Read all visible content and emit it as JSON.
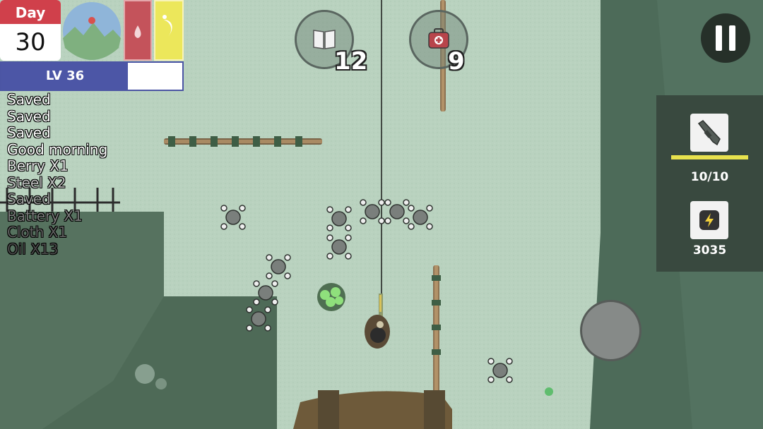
{
  "hud": {
    "day_label": "Day",
    "day_number": "30",
    "level_label": "LV 36",
    "level_progress": 0.7,
    "hydration_icon": "water-drop-icon",
    "hunger_icon": "food-crescent-icon"
  },
  "log": [
    {
      "text": "Saved",
      "color": "#ffffff"
    },
    {
      "text": "Saved",
      "color": "#ffffff"
    },
    {
      "text": "Saved",
      "color": "#ffffff"
    },
    {
      "text": "Good morning",
      "color": "#ffffff"
    },
    {
      "text": "Berry X1",
      "color": "#e4e4e4"
    },
    {
      "text": "Steel X2",
      "color": "#bcbcbc"
    },
    {
      "text": "Saved",
      "color": "#9b9b9b"
    },
    {
      "text": "Battery X1",
      "color": "#7b7b7b"
    },
    {
      "text": "Cloth X1",
      "color": "#5f5f5f"
    },
    {
      "text": "Oil X13",
      "color": "#4a4a4a"
    }
  ],
  "quick_items": {
    "journal": {
      "icon": "book-icon",
      "count": "12"
    },
    "medkit": {
      "icon": "first-aid-kit-icon",
      "count": "9"
    }
  },
  "weapon": {
    "icon": "rifle-icon",
    "ammo": "10/10",
    "ammo_fraction": 1.0
  },
  "energy": {
    "icon": "lightning-icon",
    "value": "3035"
  },
  "colors": {
    "ground": "#b9d2bf",
    "building_roof": "#4e6a57",
    "day_header": "#d0404b",
    "level_fill": "#4c56a6",
    "hydration": "#c4535b",
    "hunger": "#ece75b",
    "ammo_bar": "#e8e24e",
    "panel": "#39493f"
  }
}
